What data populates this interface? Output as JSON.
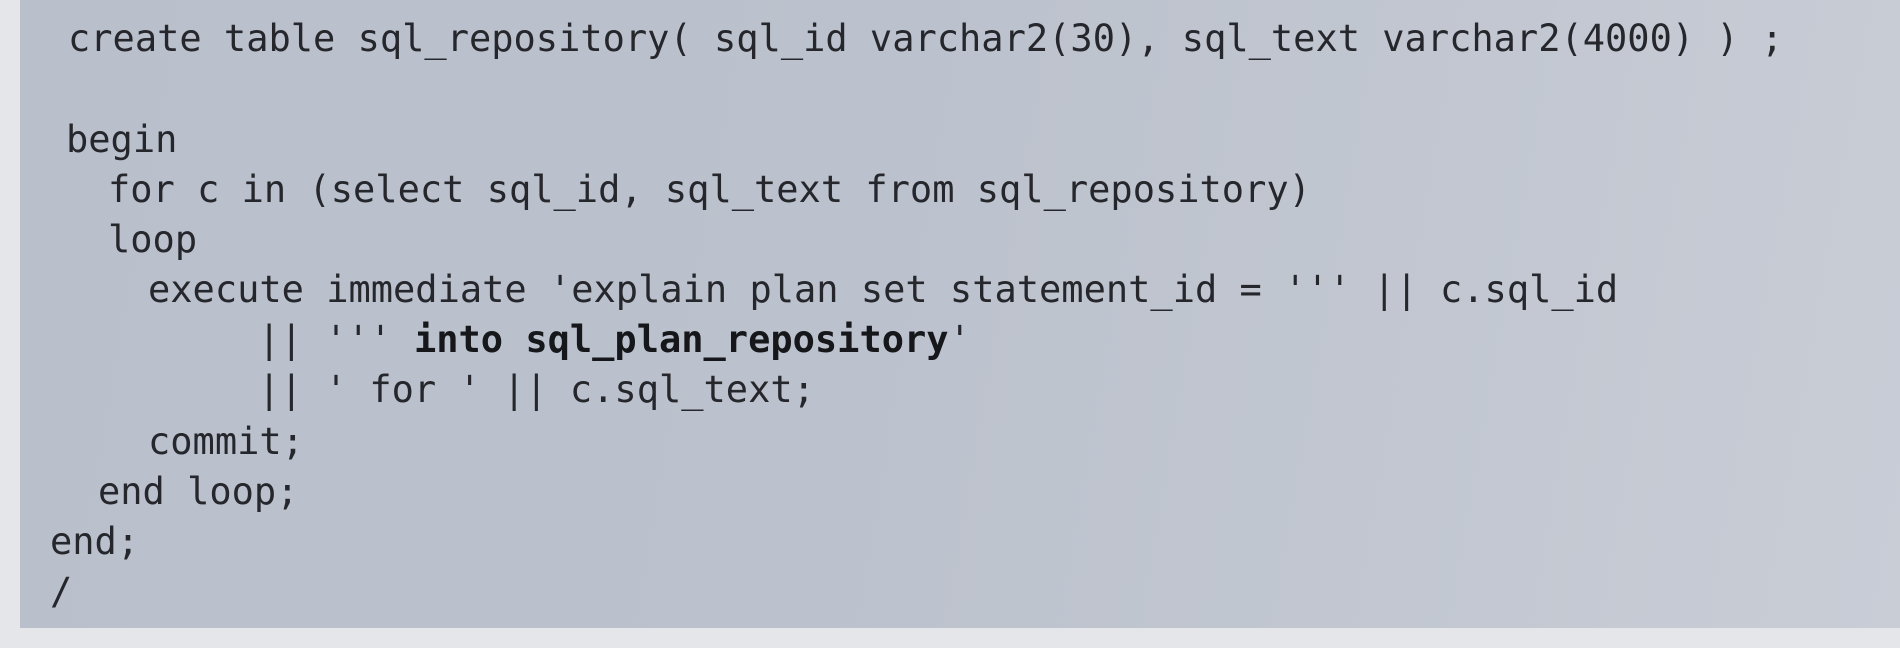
{
  "code": {
    "create_table": "create table sql_repository( sql_id varchar2(30), sql_text varchar2(4000) ) ;",
    "begin": "begin",
    "for_loop": "for c in (select sql_id, sql_text from sql_repository)",
    "loop": "loop",
    "execute_immediate": "execute immediate 'explain plan set statement_id = ''' || c.sql_id",
    "concat_prefix": "|| '''",
    "into_clause": "into sql_plan_repository",
    "concat_suffix": "'",
    "for_text": "|| ' for ' || c.sql_text;",
    "commit": "commit;",
    "end_loop": "end loop;",
    "end": "end;",
    "slash": "/"
  }
}
